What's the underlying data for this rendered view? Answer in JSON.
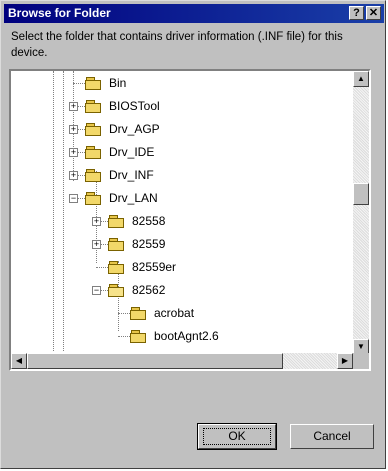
{
  "window": {
    "title": "Browse for Folder",
    "help_glyph": "?",
    "close_glyph": "✕"
  },
  "instruction": "Select the folder that contains driver information (.INF file) for this device.",
  "tree": {
    "items": [
      {
        "label": "Bin",
        "level": 1,
        "expander": "none",
        "open": false
      },
      {
        "label": "BIOSTool",
        "level": 1,
        "expander": "+",
        "open": false
      },
      {
        "label": "Drv_AGP",
        "level": 1,
        "expander": "+",
        "open": false
      },
      {
        "label": "Drv_IDE",
        "level": 1,
        "expander": "+",
        "open": false
      },
      {
        "label": "Drv_INF",
        "level": 1,
        "expander": "+",
        "open": false
      },
      {
        "label": "Drv_LAN",
        "level": 1,
        "expander": "-",
        "open": false
      },
      {
        "label": "82558",
        "level": 2,
        "expander": "+",
        "open": false
      },
      {
        "label": "82559",
        "level": 2,
        "expander": "+",
        "open": false
      },
      {
        "label": "82559er",
        "level": 2,
        "expander": "none",
        "open": false
      },
      {
        "label": "82562",
        "level": 2,
        "expander": "-",
        "open": true
      },
      {
        "label": "acrobat",
        "level": 3,
        "expander": "none",
        "open": false
      },
      {
        "label": "bootAgnt2.6",
        "level": 3,
        "expander": "none",
        "open": false
      }
    ]
  },
  "buttons": {
    "ok": "OK",
    "cancel": "Cancel"
  },
  "scroll_glyphs": {
    "up": "▲",
    "down": "▼",
    "left": "◀",
    "right": "▶"
  }
}
